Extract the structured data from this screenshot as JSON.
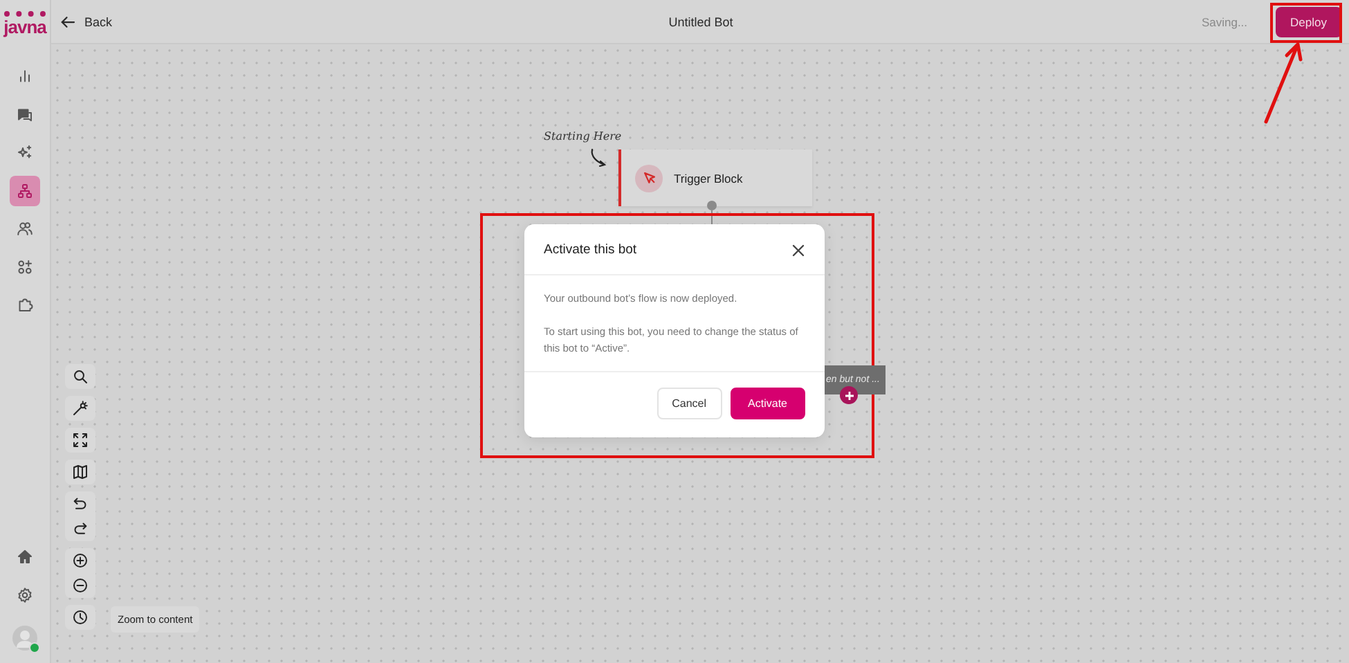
{
  "topbar": {
    "back": "Back",
    "title": "Untitled Bot",
    "status": "Saving...",
    "deploy": "Deploy"
  },
  "sidebar": {
    "logo": "javna",
    "items": [
      {
        "kind": "analytics",
        "selected": false
      },
      {
        "kind": "chat",
        "selected": false
      },
      {
        "kind": "sparkle",
        "selected": false
      },
      {
        "kind": "flow",
        "selected": true
      },
      {
        "kind": "users",
        "selected": false
      },
      {
        "kind": "apps",
        "selected": false
      },
      {
        "kind": "puzzle",
        "selected": false
      }
    ],
    "bottom": [
      {
        "kind": "home"
      },
      {
        "kind": "settings"
      }
    ],
    "avatar": {
      "online": true
    }
  },
  "canvas": {
    "note": "Starting Here",
    "trigger": {
      "label": "Trigger Block"
    },
    "partial_node": {
      "label": "en but not ..."
    },
    "tools": [
      [
        {
          "kind": "search"
        }
      ],
      [
        {
          "kind": "magic"
        }
      ],
      [
        {
          "kind": "fit"
        }
      ],
      [
        {
          "kind": "map"
        }
      ],
      [
        {
          "kind": "undo"
        },
        {
          "kind": "redo"
        }
      ],
      [
        {
          "kind": "zoom-in"
        },
        {
          "kind": "zoom-out"
        }
      ],
      [
        {
          "kind": "history"
        }
      ]
    ],
    "tooltip": "Zoom to content"
  },
  "dialog": {
    "title": "Activate this bot",
    "paragraphs": [
      "Your outbound bot’s flow is now deployed.",
      "To start using this bot, you need to change the status of this bot to “Active”."
    ],
    "buttons": [
      {
        "label": "Cancel",
        "kind": "secondary"
      },
      {
        "label": "Activate",
        "kind": "primary"
      }
    ]
  }
}
